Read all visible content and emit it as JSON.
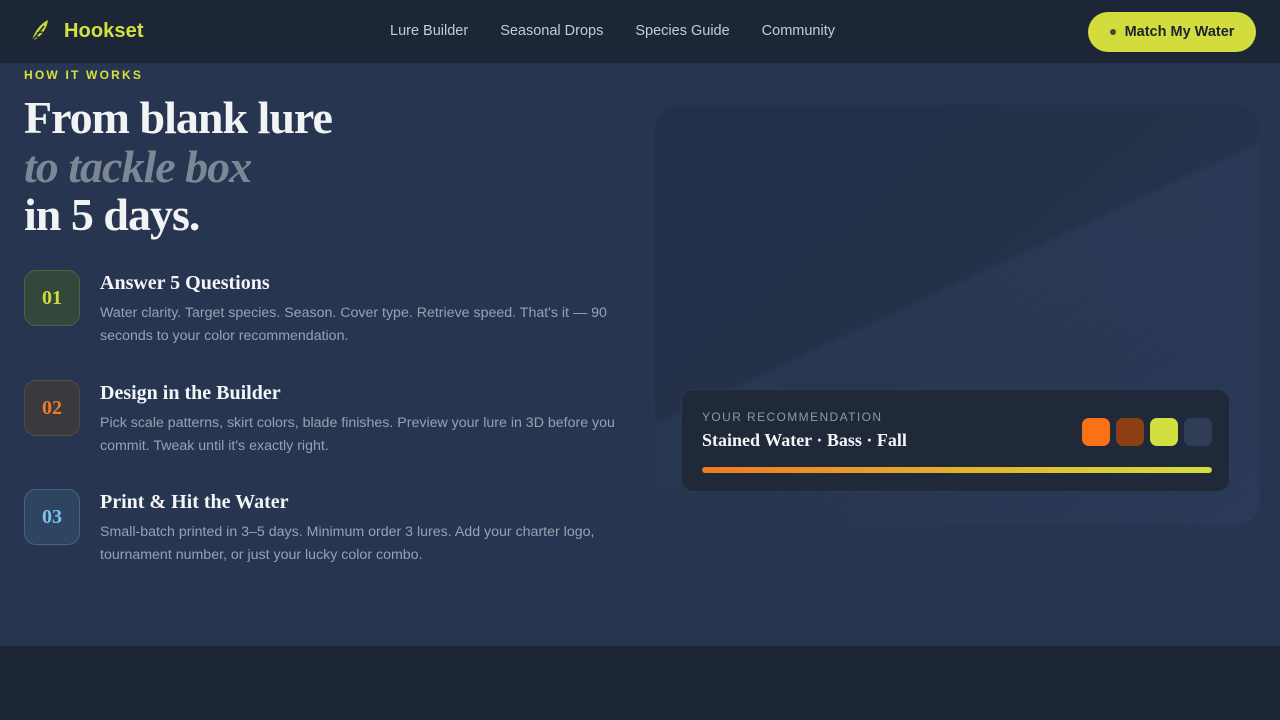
{
  "brand": {
    "name": "Hookset",
    "icon": "lure-feather-icon",
    "accent": "#d4e23f"
  },
  "nav": {
    "items": [
      "Lure Builder",
      "Seasonal Drops",
      "Species Guide",
      "Community"
    ]
  },
  "cta": {
    "label": "Match My Water"
  },
  "hero": {
    "eyebrow": "HOW IT WORKS",
    "headline_line1": "From blank lure",
    "headline_line2": "to tackle box",
    "headline_line3": "in 5 days."
  },
  "steps": [
    {
      "number": "01",
      "title": "Answer 5 Questions",
      "description": "Water clarity. Target species. Season. Cover type. Retrieve speed. That's it — 90 seconds to your color recommendation.",
      "color": "#cfdc3e"
    },
    {
      "number": "02",
      "title": "Design in the Builder",
      "description": "Pick scale patterns, skirt colors, blade finishes. Preview your lure in 3D before you commit. Tweak until it's exactly right.",
      "color": "#ef7a2a"
    },
    {
      "number": "03",
      "title": "Print & Hit the Water",
      "description": "Small-batch printed in 3–5 days. Minimum order 3 lures. Add your charter logo, tournament number, or just your lucky color combo.",
      "color": "#7ec0f0"
    }
  ],
  "recommendation": {
    "label": "YOUR RECOMMENDATION",
    "title": "Stained Water · Bass · Fall",
    "swatches": [
      "#f97316",
      "#8b3f12",
      "#d3df3e",
      "#2f3d55"
    ],
    "progress": 1.0
  }
}
